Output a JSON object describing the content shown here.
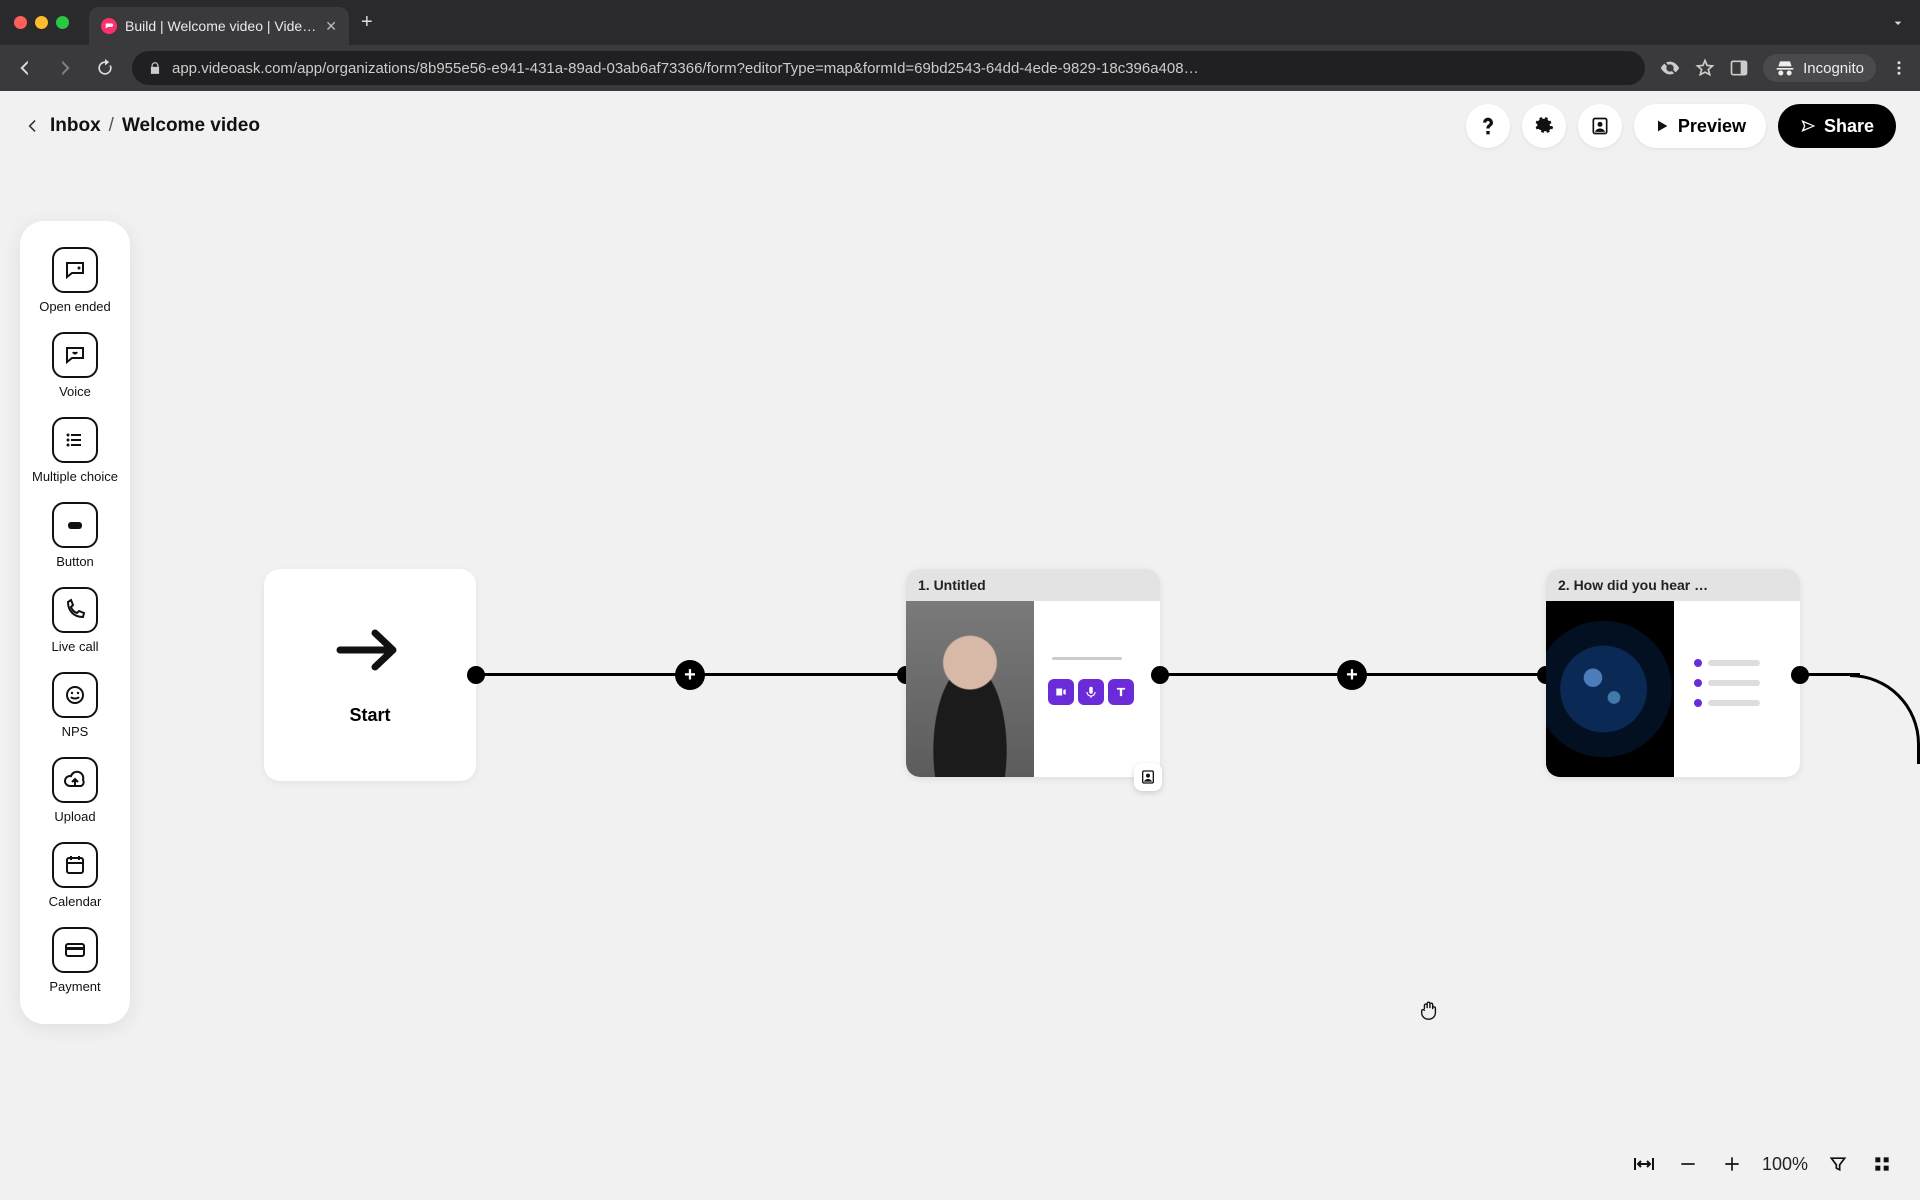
{
  "browser": {
    "tab_title": "Build | Welcome video | VideoA",
    "url": "app.videoask.com/app/organizations/8b955e56-e941-431a-89ad-03ab6af73366/form?editorType=map&formId=69bd2543-64dd-4ede-9829-18c396a408…",
    "profile_label": "Incognito"
  },
  "header": {
    "breadcrumb_inbox": "Inbox",
    "breadcrumb_sep": "/",
    "breadcrumb_current": "Welcome video",
    "preview_label": "Preview",
    "share_label": "Share"
  },
  "toolbox": [
    {
      "id": "open-ended",
      "label": "Open ended"
    },
    {
      "id": "voice",
      "label": "Voice"
    },
    {
      "id": "multiple-choice",
      "label": "Multiple choice"
    },
    {
      "id": "button",
      "label": "Button"
    },
    {
      "id": "live-call",
      "label": "Live call"
    },
    {
      "id": "nps",
      "label": "NPS"
    },
    {
      "id": "upload",
      "label": "Upload"
    },
    {
      "id": "calendar",
      "label": "Calendar"
    },
    {
      "id": "payment",
      "label": "Payment"
    }
  ],
  "flow": {
    "start_label": "Start",
    "steps": [
      {
        "title": "1. Untitled"
      },
      {
        "title": "2. How did you hear …"
      }
    ]
  },
  "zoom": {
    "level_label": "100%"
  },
  "colors": {
    "accent": "#6b2bd9",
    "node_header": "#e3e3e3"
  }
}
